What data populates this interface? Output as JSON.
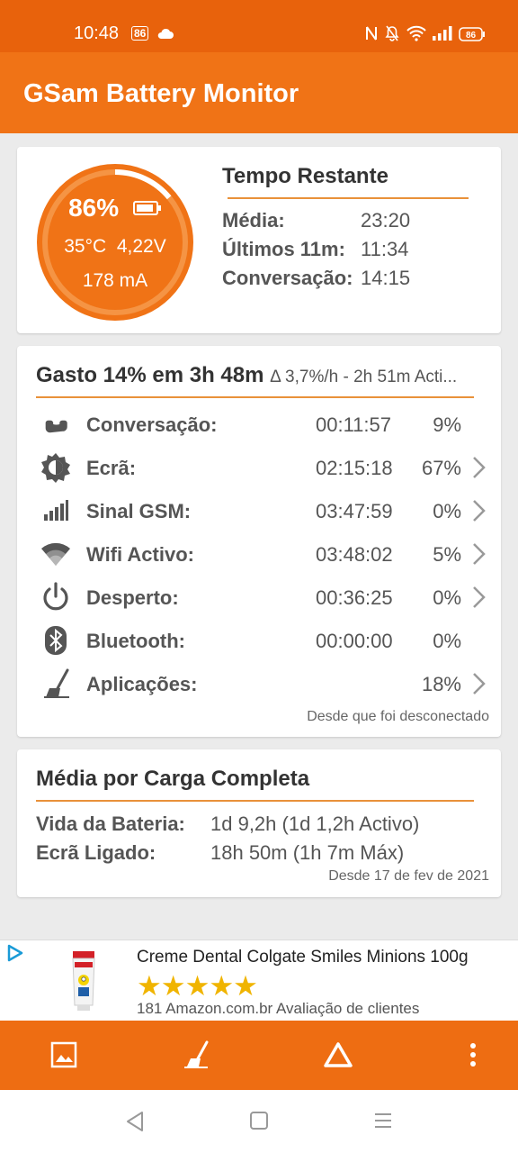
{
  "status": {
    "time": "10:48",
    "badge": "86",
    "battery": "86"
  },
  "app": {
    "title": "GSam Battery Monitor"
  },
  "battery": {
    "percent": "86%",
    "level": 0.86,
    "temperature": "35°C",
    "voltage": "4,22V",
    "current": "178 mA"
  },
  "remaining": {
    "title": "Tempo Restante",
    "rows": [
      {
        "label": "Média:",
        "value": "23:20"
      },
      {
        "label": "Últimos 11m:",
        "value": "11:34"
      },
      {
        "label": "Conversação:",
        "value": "14:15"
      }
    ]
  },
  "spent": {
    "title": "Gasto 14% em 3h 48m",
    "subtitle": "Δ 3,7%/h - 2h 51m Acti...",
    "rows": [
      {
        "icon": "phone-icon",
        "label": "Conversação:",
        "time": "00:11:57",
        "percent": "9%",
        "chevron": false
      },
      {
        "icon": "screen-brightness-icon",
        "label": "Ecrã:",
        "time": "02:15:18",
        "percent": "67%",
        "chevron": true
      },
      {
        "icon": "signal-bars-icon",
        "label": "Sinal GSM:",
        "time": "03:47:59",
        "percent": "0%",
        "chevron": true
      },
      {
        "icon": "wifi-icon",
        "label": "Wifi Activo:",
        "time": "03:48:02",
        "percent": "5%",
        "chevron": true
      },
      {
        "icon": "power-icon",
        "label": "Desperto:",
        "time": "00:36:25",
        "percent": "0%",
        "chevron": true
      },
      {
        "icon": "bluetooth-icon",
        "label": "Bluetooth:",
        "time": "00:00:00",
        "percent": "0%",
        "chevron": false
      },
      {
        "icon": "broom-icon",
        "label": "Aplicações:",
        "time": "",
        "percent": "18%",
        "chevron": true
      }
    ],
    "note": "Desde que foi desconectado"
  },
  "average": {
    "title": "Média por Carga Completa",
    "rows": [
      {
        "label": "Vida da Bateria:",
        "value": "1d 9,2h (1d 1,2h Activo)"
      },
      {
        "label": "Ecrã Ligado:",
        "value": "18h 50m (1h 7m Máx)"
      }
    ],
    "note": "Desde 17 de fev de 2021"
  },
  "ad": {
    "title": "Creme Dental Colgate Smiles Minions 100g",
    "stars": "★★★★★",
    "rating": 5,
    "reviews": "181 Amazon.com.br Avaliação de clientes"
  },
  "colors": {
    "primary": "#f07316",
    "statusbar": "#e8620c",
    "accent": "#e9913a",
    "gauge": "#f07316"
  }
}
